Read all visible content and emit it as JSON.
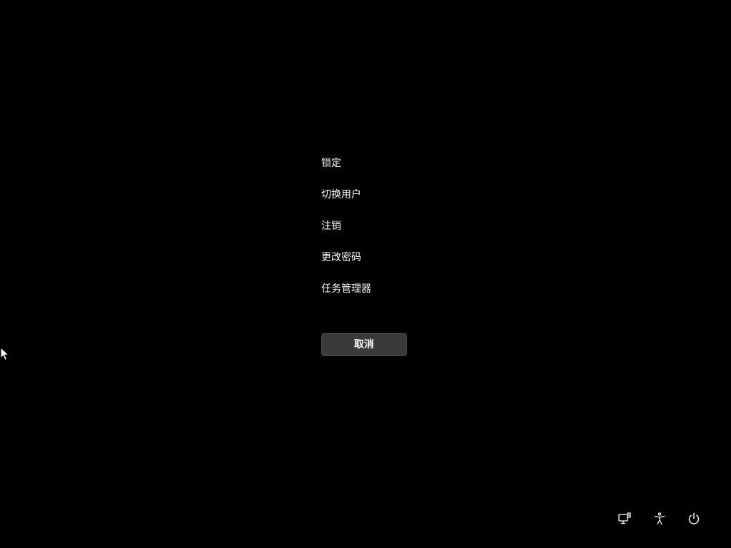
{
  "menu": {
    "items": [
      {
        "label": "锁定"
      },
      {
        "label": "切换用户"
      },
      {
        "label": "注销"
      },
      {
        "label": "更改密码"
      },
      {
        "label": "任务管理器"
      }
    ],
    "cancel_label": "取消"
  },
  "system_icons": {
    "network": "network-icon",
    "accessibility": "accessibility-icon",
    "power": "power-icon"
  },
  "colors": {
    "background": "#000000",
    "text": "#ffffff",
    "button_bg": "#3a3a3a"
  }
}
